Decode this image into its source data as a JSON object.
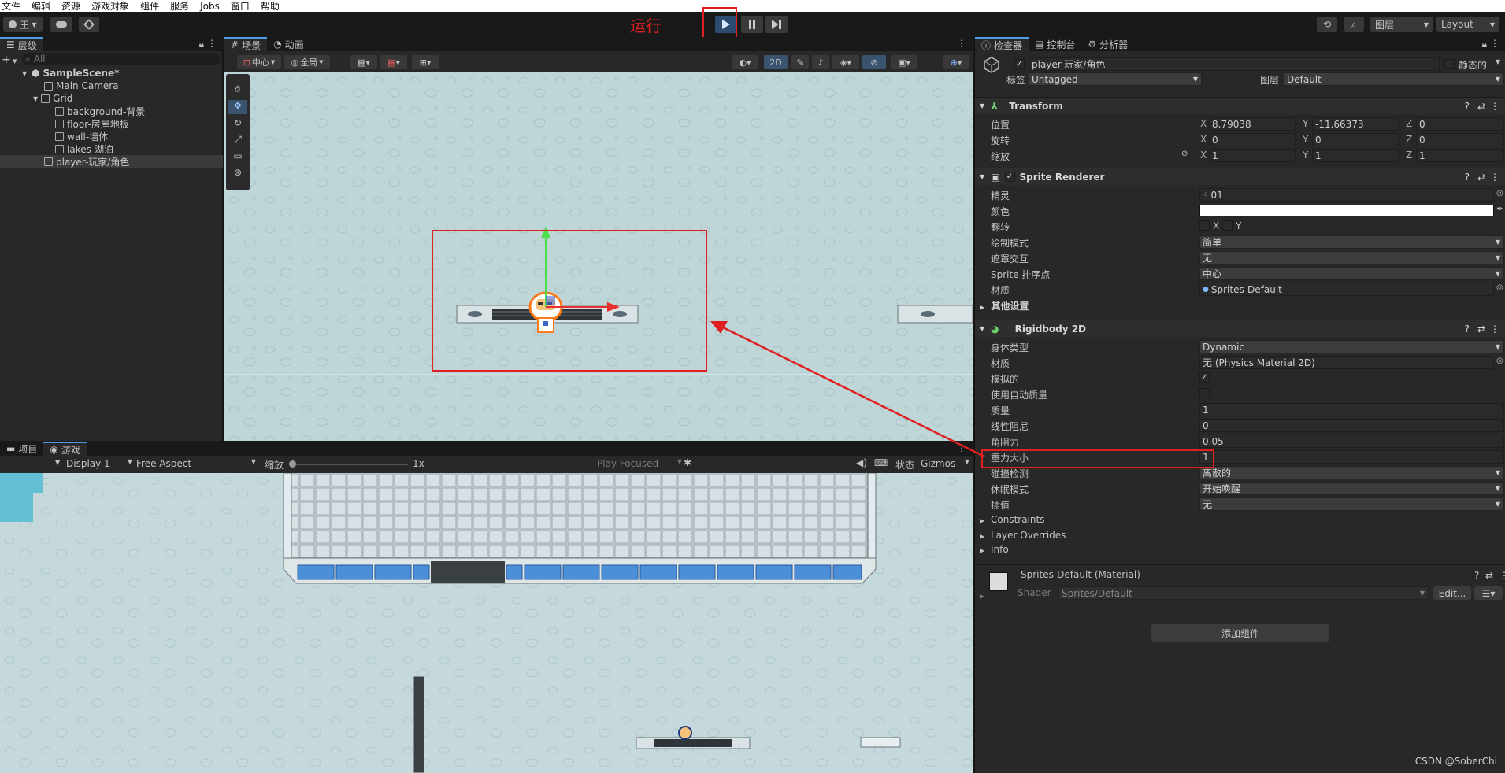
{
  "menu": [
    "文件",
    "编辑",
    "资源",
    "游戏对象",
    "组件",
    "服务",
    "Jobs",
    "窗口",
    "帮助"
  ],
  "toolbar": {
    "account": "王",
    "run_annotation": "运行",
    "layers": "图层",
    "layout": "Layout"
  },
  "hierarchy": {
    "tab": "层级",
    "search_placeholder": "All",
    "scene": "SampleScene*",
    "items": [
      "Main Camera",
      "Grid",
      "background-背景",
      "floor-房屋地板",
      "wall-墙体",
      "lakes-湖泊",
      "player-玩家/角色"
    ]
  },
  "scene": {
    "tabs": [
      "场景",
      "动画"
    ],
    "pivot": "中心",
    "global": "全局",
    "mode_2d": "2D"
  },
  "game": {
    "tabs": [
      "项目",
      "游戏"
    ],
    "display": "Display 1",
    "aspect": "Free Aspect",
    "scale_label": "缩放",
    "scale_value": "1x",
    "play_focused": "Play Focused",
    "stats": "状态",
    "gizmos": "Gizmos"
  },
  "inspector": {
    "tabs": [
      "检查器",
      "控制台",
      "分析器"
    ],
    "object_name": "player-玩家/角色",
    "static_label": "静态的",
    "tag_label": "标签",
    "tag_value": "Untagged",
    "layer_label": "图层",
    "layer_value": "Default",
    "transform": {
      "title": "Transform",
      "position_label": "位置",
      "rotation_label": "旋转",
      "scale_label": "缩放",
      "position": {
        "x": "8.79038",
        "y": "-11.66373",
        "z": "0"
      },
      "rotation": {
        "x": "0",
        "y": "0",
        "z": "0"
      },
      "scale": {
        "x": "1",
        "y": "1",
        "z": "1"
      }
    },
    "sprite_renderer": {
      "title": "Sprite Renderer",
      "sprite_label": "精灵",
      "sprite_value": "01",
      "color_label": "颜色",
      "flip_label": "翻转",
      "draw_mode_label": "绘制模式",
      "draw_mode_value": "简单",
      "mask_label": "遮罩交互",
      "mask_value": "无",
      "sort_point_label": "Sprite 排序点",
      "sort_point_value": "中心",
      "material_label": "材质",
      "material_value": "Sprites-Default",
      "other_settings": "其他设置"
    },
    "rigidbody": {
      "title": "Rigidbody 2D",
      "body_type_label": "身体类型",
      "body_type_value": "Dynamic",
      "material_label": "材质",
      "material_value": "无 (Physics Material 2D)",
      "simulated_label": "模拟的",
      "auto_mass_label": "使用自动质量",
      "mass_label": "质量",
      "mass_value": "1",
      "linear_drag_label": "线性阻尼",
      "linear_drag_value": "0",
      "angular_drag_label": "角阻力",
      "angular_drag_value": "0.05",
      "gravity_label": "重力大小",
      "gravity_value": "1",
      "collision_label": "碰撞检测",
      "collision_value": "离散的",
      "sleep_label": "休眠模式",
      "sleep_value": "开始唤醒",
      "interp_label": "插值",
      "interp_value": "无",
      "constraints": "Constraints",
      "layer_overrides": "Layer Overrides",
      "info": "Info"
    },
    "material": {
      "title": "Sprites-Default (Material)",
      "shader_label": "Shader",
      "shader_value": "Sprites/Default",
      "edit": "Edit..."
    },
    "add_component": "添加组件"
  },
  "watermark": "CSDN @SoberChi",
  "colors": {
    "accent": "#4f9ce6",
    "annotation": "#e02020",
    "play_icon": "#7fb6ff"
  }
}
